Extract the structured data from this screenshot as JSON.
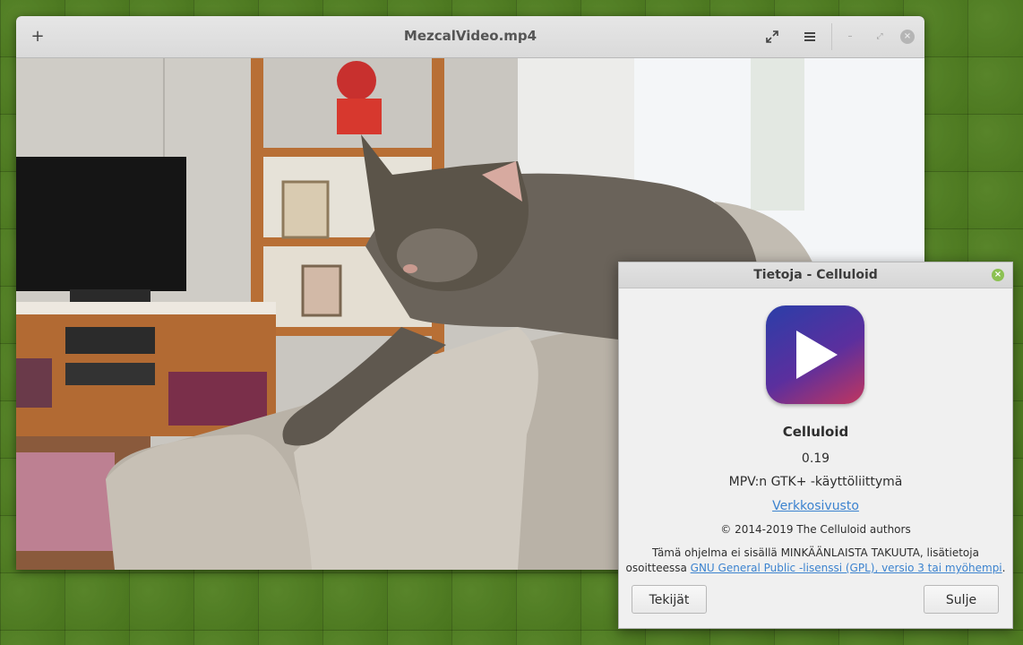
{
  "window": {
    "title": "MezcalVideo.mp4",
    "new_button": "+",
    "fullscreen_icon": "fullscreen-icon",
    "menu_icon": "hamburger-menu-icon",
    "minimize": "–",
    "maximize": "⤢",
    "close": "×"
  },
  "about": {
    "title": "Tietoja - Celluloid",
    "close": "×",
    "app_name": "Celluloid",
    "version": "0.19",
    "comment": "MPV:n GTK+ -käyttöliittymä",
    "website": "Verkkosivusto",
    "copyright": "© 2014-2019 The Celluloid authors",
    "license_line1": "Tämä ohjelma ei sisällä MINKÄÄNLAISTA TAKUUTA, lisätietoja",
    "license_prefix": "osoitteessa",
    "license_link": "GNU General Public -lisenssi (GPL), versio 3 tai myöhempi",
    "license_suffix": ".",
    "credits_button": "Tekijät",
    "close_button": "Sulje"
  }
}
